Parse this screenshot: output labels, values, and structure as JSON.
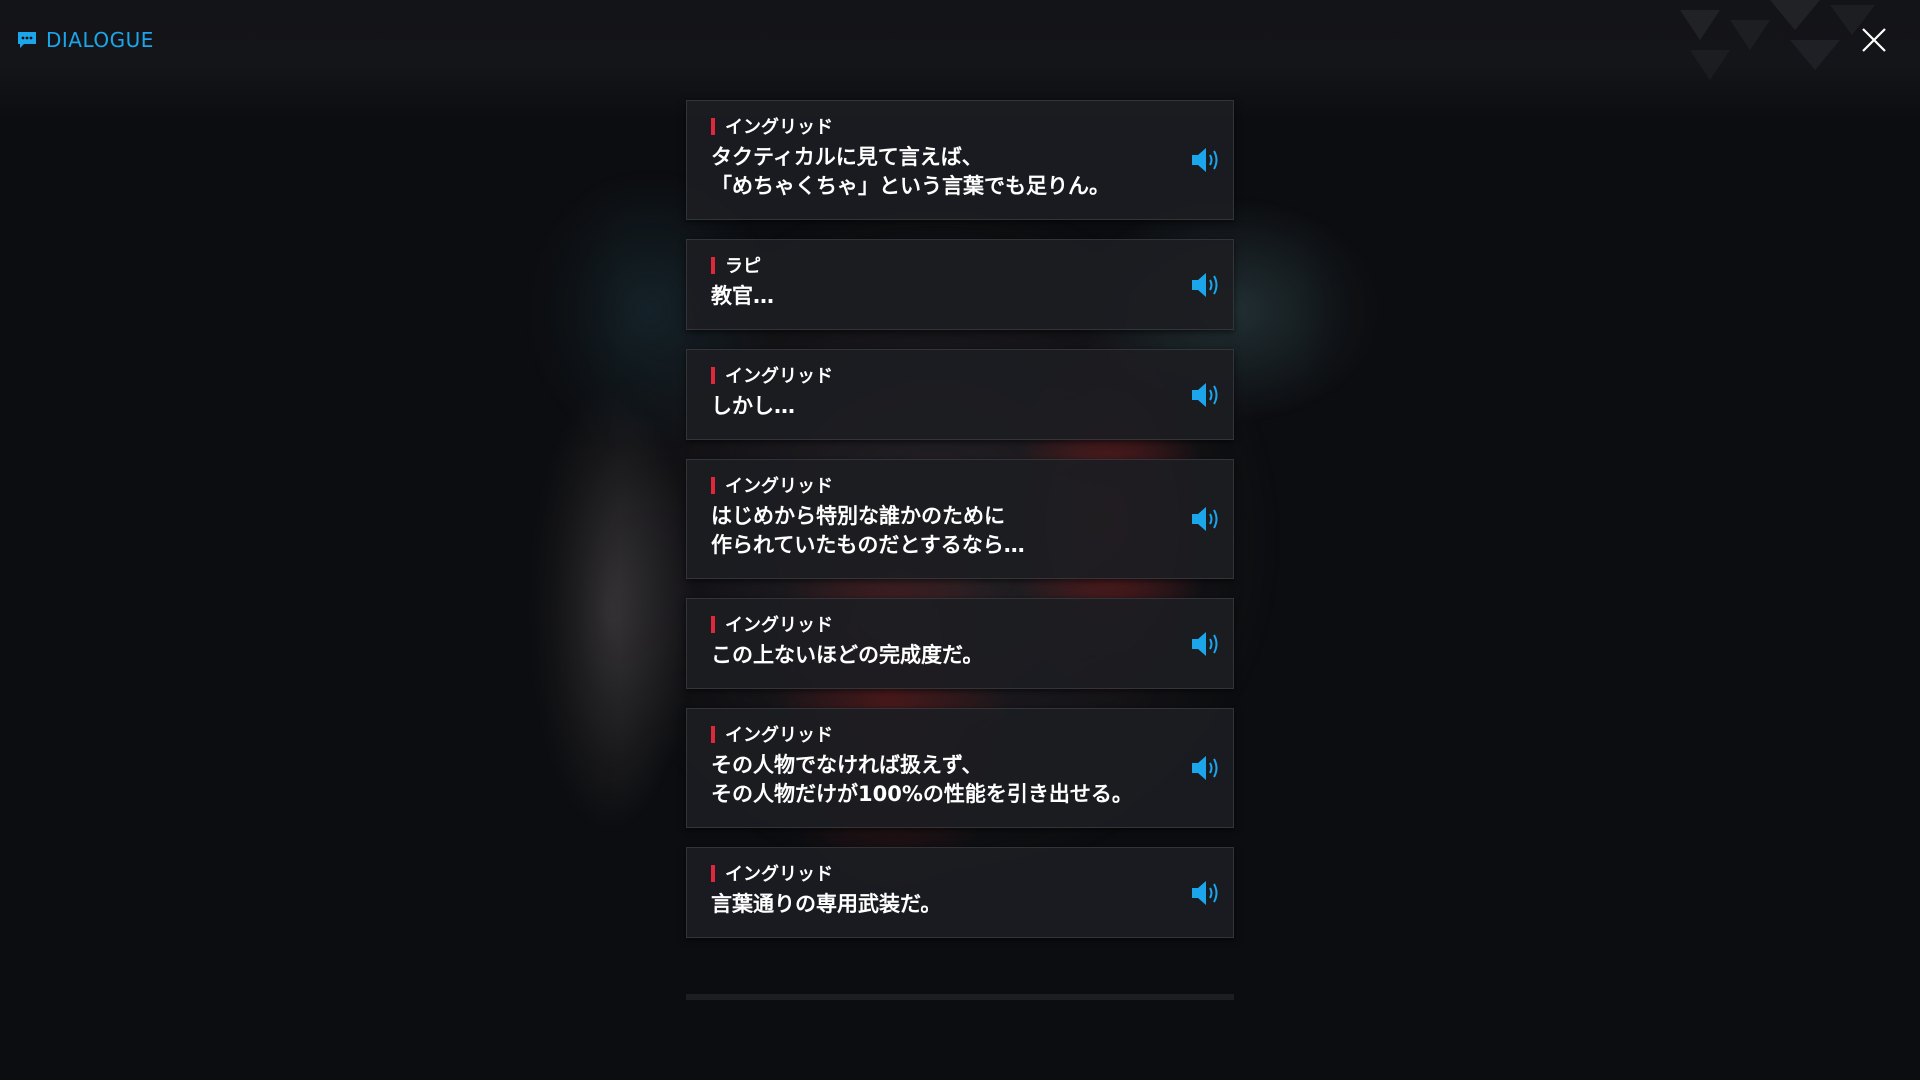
{
  "header": {
    "title": "DIALOGUE",
    "dialogue_icon": "chat-bubble-icon",
    "close_icon": "close-icon"
  },
  "colors": {
    "accent": "#1ba6ec",
    "speaker_marker": "#e0283a",
    "card_bg": "#1c1d21",
    "background": "#0c0d10"
  },
  "dialogue": [
    {
      "speaker": "イングリッド",
      "lines": [
        "タクティカルに見て言えば、",
        "「めちゃくちゃ」という言葉でも足りん。"
      ],
      "voice_icon": "speaker-volume-icon"
    },
    {
      "speaker": "ラピ",
      "lines": [
        "教官…"
      ],
      "voice_icon": "speaker-volume-icon"
    },
    {
      "speaker": "イングリッド",
      "lines": [
        "しかし…"
      ],
      "voice_icon": "speaker-volume-icon"
    },
    {
      "speaker": "イングリッド",
      "lines": [
        "はじめから特別な誰かのために",
        "作られていたものだとするなら…"
      ],
      "voice_icon": "speaker-volume-icon"
    },
    {
      "speaker": "イングリッド",
      "lines": [
        "この上ないほどの完成度だ。"
      ],
      "voice_icon": "speaker-volume-icon"
    },
    {
      "speaker": "イングリッド",
      "lines": [
        "その人物でなければ扱えず、",
        "その人物だけが100%の性能を引き出せる。"
      ],
      "voice_icon": "speaker-volume-icon"
    },
    {
      "speaker": "イングリッド",
      "lines": [
        "言葉通りの専用武装だ。"
      ],
      "voice_icon": "speaker-volume-icon"
    }
  ]
}
